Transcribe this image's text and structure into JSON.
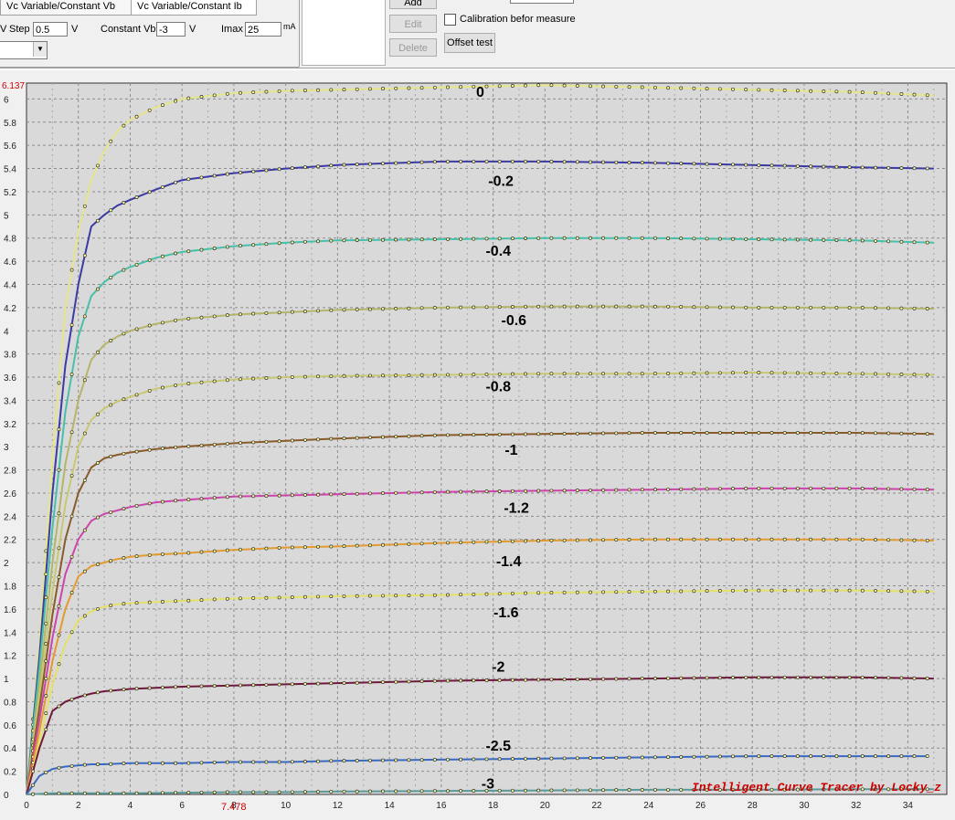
{
  "toolbar": {
    "tabs": [
      {
        "label": "Vc Variable/Constant Vb"
      },
      {
        "label": "Vc Variable/Constant Ib"
      }
    ],
    "vc_label": "V",
    "step_label": "Step",
    "step_value": "0.5",
    "step_unit": "V",
    "constant_vb_label": "Constant Vb",
    "constant_vb_value": "-3",
    "constant_vb_unit": "V",
    "imax_label": "Imax",
    "imax_value": "25",
    "imax_unit": "mA",
    "add_label": "Add",
    "edit_label": "Edit",
    "delete_label": "Delete",
    "calibration_label": "Calibration befor measure",
    "offset_test_label": "Offset test"
  },
  "plot": {
    "y_max_marker": "6.137",
    "x_cursor_marker": "7.478",
    "watermark": "Intelligent Curve Tracer by Locky_z",
    "x_ticks": [
      "0",
      "2",
      "4",
      "6",
      "8",
      "10",
      "12",
      "14",
      "16",
      "18",
      "20",
      "22",
      "24",
      "26",
      "28",
      "30",
      "32",
      "34"
    ],
    "y_ticks": [
      "0",
      "0.2",
      "0.4",
      "0.6",
      "0.8",
      "1",
      "1.2",
      "1.4",
      "1.6",
      "1.8",
      "2",
      "2.2",
      "2.4",
      "2.6",
      "2.8",
      "3",
      "3.2",
      "3.4",
      "3.6",
      "3.8",
      "4",
      "4.2",
      "4.4",
      "4.6",
      "4.8",
      "5",
      "5.2",
      "5.4",
      "5.6",
      "5.8",
      "6"
    ],
    "colors": {
      "background": "#d9d9d9",
      "grid": "#8c8c8c",
      "marker": "#cc0000"
    }
  },
  "chart_data": {
    "type": "line",
    "xlim": [
      0,
      35.5
    ],
    "ylim": [
      0,
      6.137
    ],
    "grid": true,
    "series": [
      {
        "name": "0",
        "color": "#e5e58a",
        "label_x": 17.5,
        "label_y": 6.02,
        "x": [
          0,
          0.5,
          1,
          1.5,
          2,
          2.5,
          3,
          3.5,
          4,
          5,
          6,
          8,
          10,
          12,
          16,
          20,
          24,
          28,
          32,
          35
        ],
        "y": [
          0,
          1.3,
          2.9,
          4.2,
          4.85,
          5.3,
          5.55,
          5.72,
          5.82,
          5.93,
          6.0,
          6.05,
          6.07,
          6.08,
          6.1,
          6.12,
          6.1,
          6.08,
          6.06,
          6.03
        ]
      },
      {
        "name": "-0.2",
        "color": "#3b3ba3",
        "label_x": 18.3,
        "label_y": 5.25,
        "x": [
          0,
          0.5,
          1,
          1.5,
          2,
          2.5,
          3,
          3.5,
          4,
          5,
          6,
          8,
          10,
          12,
          16,
          20,
          24,
          28,
          32,
          35
        ],
        "y": [
          0,
          1.2,
          2.6,
          3.7,
          4.4,
          4.9,
          5.0,
          5.08,
          5.13,
          5.22,
          5.3,
          5.36,
          5.4,
          5.43,
          5.46,
          5.46,
          5.45,
          5.43,
          5.41,
          5.4
        ]
      },
      {
        "name": "-0.4",
        "color": "#48c0a8",
        "label_x": 18.2,
        "label_y": 4.65,
        "x": [
          0,
          0.5,
          1,
          1.5,
          2,
          2.5,
          3,
          3.5,
          4,
          5,
          6,
          8,
          10,
          12,
          16,
          20,
          24,
          28,
          32,
          35
        ],
        "y": [
          0,
          1.1,
          2.3,
          3.3,
          3.95,
          4.3,
          4.42,
          4.5,
          4.55,
          4.63,
          4.68,
          4.73,
          4.76,
          4.78,
          4.79,
          4.8,
          4.8,
          4.79,
          4.78,
          4.76
        ]
      },
      {
        "name": "-0.6",
        "color": "#b5b56a",
        "label_x": 18.8,
        "label_y": 4.05,
        "x": [
          0,
          0.5,
          1,
          1.5,
          2,
          2.5,
          3,
          3.5,
          4,
          5,
          6,
          8,
          10,
          12,
          16,
          20,
          24,
          28,
          32,
          35
        ],
        "y": [
          0,
          0.95,
          2.0,
          2.85,
          3.4,
          3.75,
          3.88,
          3.95,
          4.0,
          4.06,
          4.1,
          4.14,
          4.16,
          4.18,
          4.2,
          4.21,
          4.21,
          4.2,
          4.2,
          4.19
        ]
      },
      {
        "name": "-0.8",
        "color": "#c8c870",
        "label_x": 18.2,
        "label_y": 3.48,
        "x": [
          0,
          0.5,
          1,
          1.5,
          2,
          2.5,
          3,
          3.5,
          4,
          5,
          6,
          8,
          10,
          12,
          16,
          20,
          24,
          28,
          32,
          35
        ],
        "y": [
          0,
          0.85,
          1.75,
          2.5,
          3.0,
          3.23,
          3.33,
          3.39,
          3.43,
          3.5,
          3.54,
          3.58,
          3.6,
          3.61,
          3.62,
          3.63,
          3.63,
          3.64,
          3.63,
          3.62
        ]
      },
      {
        "name": "-1",
        "color": "#8b5a2b",
        "label_x": 18.7,
        "label_y": 2.93,
        "x": [
          0,
          0.5,
          1,
          1.5,
          2,
          2.5,
          3,
          3.5,
          4,
          5,
          6,
          8,
          10,
          12,
          16,
          20,
          24,
          28,
          32,
          35
        ],
        "y": [
          0,
          0.75,
          1.55,
          2.2,
          2.6,
          2.82,
          2.9,
          2.93,
          2.95,
          2.98,
          3.0,
          3.03,
          3.05,
          3.07,
          3.1,
          3.11,
          3.12,
          3.12,
          3.12,
          3.11
        ]
      },
      {
        "name": "-1.2",
        "color": "#cc44aa",
        "label_x": 18.9,
        "label_y": 2.43,
        "x": [
          0,
          0.5,
          1,
          1.5,
          2,
          2.5,
          3,
          3.5,
          4,
          5,
          6,
          8,
          10,
          12,
          16,
          20,
          24,
          28,
          32,
          35
        ],
        "y": [
          0,
          0.65,
          1.35,
          1.9,
          2.2,
          2.36,
          2.42,
          2.45,
          2.48,
          2.52,
          2.54,
          2.57,
          2.58,
          2.59,
          2.61,
          2.62,
          2.63,
          2.64,
          2.64,
          2.63
        ]
      },
      {
        "name": "-1.4",
        "color": "#e39a2e",
        "label_x": 18.6,
        "label_y": 1.97,
        "x": [
          0,
          0.5,
          1,
          1.5,
          2,
          2.5,
          3,
          3.5,
          4,
          5,
          6,
          8,
          10,
          12,
          16,
          20,
          24,
          28,
          32,
          35
        ],
        "y": [
          0,
          0.55,
          1.15,
          1.6,
          1.88,
          1.97,
          2.0,
          2.03,
          2.05,
          2.07,
          2.08,
          2.11,
          2.13,
          2.14,
          2.17,
          2.19,
          2.2,
          2.2,
          2.2,
          2.19
        ]
      },
      {
        "name": "-1.6",
        "color": "#e5e066",
        "label_x": 18.5,
        "label_y": 1.53,
        "x": [
          0,
          0.5,
          1,
          1.5,
          2,
          2.5,
          3,
          3.5,
          4,
          5,
          6,
          8,
          10,
          12,
          16,
          20,
          24,
          28,
          32,
          35
        ],
        "y": [
          0,
          0.45,
          0.95,
          1.3,
          1.5,
          1.58,
          1.62,
          1.64,
          1.65,
          1.66,
          1.67,
          1.69,
          1.7,
          1.71,
          1.72,
          1.74,
          1.75,
          1.76,
          1.76,
          1.75
        ]
      },
      {
        "name": "-2",
        "color": "#6e1a3a",
        "label_x": 18.2,
        "label_y": 1.06,
        "x": [
          0,
          0.5,
          1,
          1.5,
          2,
          2.5,
          3,
          3.5,
          4,
          5,
          6,
          8,
          10,
          12,
          16,
          20,
          24,
          28,
          32,
          35
        ],
        "y": [
          0,
          0.4,
          0.72,
          0.8,
          0.84,
          0.87,
          0.89,
          0.9,
          0.91,
          0.92,
          0.93,
          0.94,
          0.95,
          0.96,
          0.98,
          0.99,
          1.0,
          1.01,
          1.01,
          1.0
        ]
      },
      {
        "name": "-2.5",
        "color": "#3a6ac0",
        "label_x": 18.2,
        "label_y": 0.38,
        "x": [
          0,
          0.5,
          1,
          1.5,
          2,
          2.5,
          3,
          4,
          5,
          6,
          8,
          10,
          12,
          16,
          20,
          24,
          28,
          32,
          34.8
        ],
        "y": [
          0,
          0.16,
          0.22,
          0.24,
          0.25,
          0.26,
          0.26,
          0.27,
          0.27,
          0.27,
          0.28,
          0.28,
          0.29,
          0.3,
          0.31,
          0.32,
          0.33,
          0.33,
          0.33
        ]
      },
      {
        "name": "-3",
        "color": "#5a9a9a",
        "label_x": 17.8,
        "label_y": 0.05,
        "x": [
          0,
          0.5,
          1,
          2,
          4,
          6,
          8,
          10,
          12,
          16,
          20,
          24,
          28,
          32,
          35
        ],
        "y": [
          0,
          0.005,
          0.01,
          0.01,
          0.01,
          0.015,
          0.02,
          0.02,
          0.025,
          0.03,
          0.035,
          0.04,
          0.04,
          0.045,
          0.045
        ]
      }
    ]
  }
}
